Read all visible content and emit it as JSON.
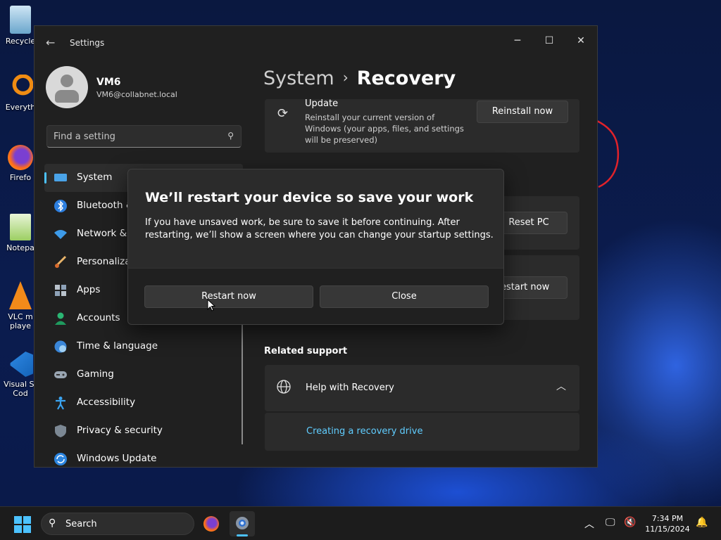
{
  "desktop": {
    "icons": [
      {
        "label": "Recycle"
      },
      {
        "label": "Everyth"
      },
      {
        "label": "Firefo"
      },
      {
        "label": "Notepa"
      },
      {
        "label": "VLC m\nplaye"
      },
      {
        "label": "Visual St\nCod"
      }
    ]
  },
  "window": {
    "title": "Settings",
    "profile": {
      "name": "VM6",
      "email": "VM6@collabnet.local"
    },
    "search": {
      "placeholder": "Find a setting"
    },
    "nav": [
      {
        "label": "System",
        "icon": "monitor-icon",
        "active": true
      },
      {
        "label": "Bluetooth &",
        "icon": "bluetooth-icon"
      },
      {
        "label": "Network &",
        "icon": "wifi-icon"
      },
      {
        "label": "Personalizat",
        "icon": "brush-icon"
      },
      {
        "label": "Apps",
        "icon": "apps-icon"
      },
      {
        "label": "Accounts",
        "icon": "person-icon"
      },
      {
        "label": "Time & language",
        "icon": "globe-clock-icon"
      },
      {
        "label": "Gaming",
        "icon": "gamepad-icon"
      },
      {
        "label": "Accessibility",
        "icon": "accessibility-icon"
      },
      {
        "label": "Privacy & security",
        "icon": "shield-icon"
      },
      {
        "label": "Windows Update",
        "icon": "update-icon"
      }
    ],
    "breadcrumb": {
      "parent": "System",
      "separator": "›",
      "current": "Recovery"
    },
    "update_card": {
      "title": "Update",
      "desc": "Reinstall your current version of Windows (your apps, files, and settings will be preserved)",
      "button": "Reinstall now"
    },
    "reset_button": "Reset PC",
    "restart_button_partial": "estart now",
    "related_support": {
      "title": "Related support",
      "help_label": "Help with Recovery",
      "link": "Creating a recovery drive"
    }
  },
  "dialog": {
    "title": "We’ll restart your device so save your work",
    "body": "If you have unsaved work, be sure to save it before continuing. After restarting, we’ll show a screen where you can change your startup settings.",
    "primary": "Restart now",
    "secondary": "Close"
  },
  "taskbar": {
    "search_label": "Search",
    "time": "7:34 PM",
    "date": "11/15/2024"
  },
  "colors": {
    "accent": "#4cc2ff",
    "link": "#60cdff",
    "window_bg": "#202020",
    "card_bg": "#2b2b2b"
  }
}
